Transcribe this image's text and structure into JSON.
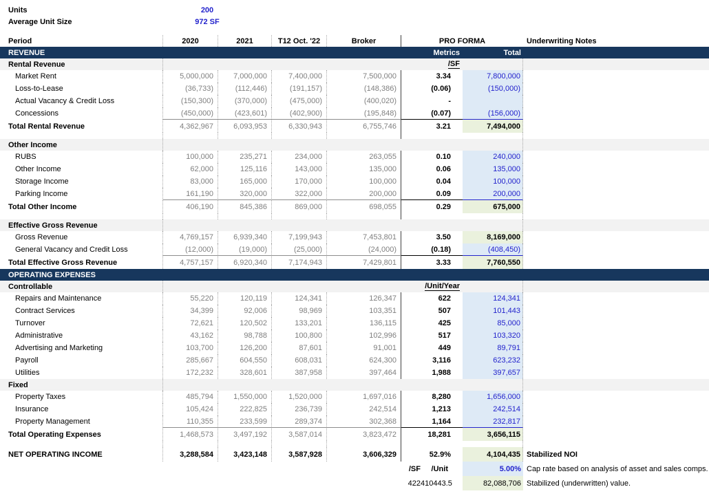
{
  "theme": {
    "navy": "#17375D",
    "blue": "#2222CC",
    "lightblue": "#DEEAF6",
    "green": "#EAF1DD",
    "gray": "#7F7F7F",
    "band": "#F2F2F2"
  },
  "info": {
    "units_label": "Units",
    "units_value": "200",
    "avg_unit_size_label": "Average Unit Size",
    "avg_unit_size_value": "972 SF"
  },
  "columns": {
    "period": "Period",
    "y2020": "2020",
    "y2021": "2021",
    "t12": "T12 Oct. '22",
    "broker": "Broker",
    "pro_forma": "PRO FORMA",
    "metrics": "Metrics",
    "total": "Total",
    "notes": "Underwriting Notes"
  },
  "rows": [
    {
      "type": "colheader"
    },
    {
      "type": "bar",
      "label": "REVENUE",
      "metrics_label": "Metrics",
      "total_label": "Total"
    },
    {
      "type": "sub",
      "label": "Rental Revenue",
      "metrics_header": "/SF"
    },
    {
      "type": "data",
      "label": "Market Rent",
      "values": [
        "5,000,000",
        "7,000,000",
        "7,400,000",
        "7,500,000"
      ],
      "metrics": "3.34",
      "total": "7,800,000",
      "highlight": "blue"
    },
    {
      "type": "data",
      "label": "Loss-to-Lease",
      "values": [
        "(36,733)",
        "(112,446)",
        "(191,157)",
        "(148,386)"
      ],
      "metrics": "(0.06)",
      "total": "(150,000)",
      "highlight": "blue"
    },
    {
      "type": "data",
      "label": "Actual Vacancy & Credit Loss",
      "values": [
        "(150,300)",
        "(370,000)",
        "(475,000)",
        "(400,020)"
      ],
      "metrics": "-",
      "total": "",
      "highlight": "blue"
    },
    {
      "type": "data",
      "label": "Concessions",
      "values": [
        "(450,000)",
        "(423,601)",
        "(402,900)",
        "(195,848)"
      ],
      "metrics": "(0.07)",
      "total": "(156,000)",
      "highlight": "blue",
      "underline": true
    },
    {
      "type": "total",
      "label": "Total Rental Revenue",
      "values": [
        "4,362,967",
        "6,093,953",
        "6,330,943",
        "6,755,746"
      ],
      "metrics": "3.21",
      "total": "7,494,000"
    },
    {
      "type": "gap"
    },
    {
      "type": "sub",
      "label": "Other Income"
    },
    {
      "type": "data",
      "label": "RUBS",
      "values": [
        "100,000",
        "235,271",
        "234,000",
        "263,055"
      ],
      "metrics": "0.10",
      "total": "240,000",
      "highlight": "blue"
    },
    {
      "type": "data",
      "label": "Other Income",
      "values": [
        "62,000",
        "125,116",
        "143,000",
        "135,000"
      ],
      "metrics": "0.06",
      "total": "135,000",
      "highlight": "blue"
    },
    {
      "type": "data",
      "label": "Storage Income",
      "values": [
        "83,000",
        "165,000",
        "170,000",
        "100,000"
      ],
      "metrics": "0.04",
      "total": "100,000",
      "highlight": "blue"
    },
    {
      "type": "data",
      "label": "Parking Income",
      "values": [
        "161,190",
        "320,000",
        "322,000",
        "200,000"
      ],
      "metrics": "0.09",
      "total": "200,000",
      "highlight": "blue",
      "underline": true
    },
    {
      "type": "total",
      "label": "Total Other Income",
      "values": [
        "406,190",
        "845,386",
        "869,000",
        "698,055"
      ],
      "metrics": "0.29",
      "total": "675,000"
    },
    {
      "type": "gap"
    },
    {
      "type": "sub",
      "label": "Effective Gross Revenue"
    },
    {
      "type": "data",
      "label": "Gross Revenue",
      "values": [
        "4,769,157",
        "6,939,340",
        "7,199,943",
        "7,453,801"
      ],
      "metrics": "3.50",
      "total": "8,169,000",
      "highlight": "green"
    },
    {
      "type": "data",
      "label": "General Vacancy and Credit Loss",
      "values": [
        "(12,000)",
        "(19,000)",
        "(25,000)",
        "(24,000)"
      ],
      "metrics": "(0.18)",
      "total": "(408,450)",
      "highlight": "blue",
      "underline": true
    },
    {
      "type": "total",
      "label": "Total Effective Gross Revenue",
      "values": [
        "4,757,157",
        "6,920,340",
        "7,174,943",
        "7,429,801"
      ],
      "metrics": "3.33",
      "total": "7,760,550"
    },
    {
      "type": "bar",
      "label": "OPERATING EXPENSES",
      "metrics_label": "",
      "total_label": ""
    },
    {
      "type": "sub",
      "label": "Controllable",
      "metrics_header": "/Unit/Year"
    },
    {
      "type": "data",
      "label": "Repairs and Maintenance",
      "values": [
        "55,220",
        "120,119",
        "124,341",
        "126,347"
      ],
      "metrics": "622",
      "total": "124,341",
      "highlight": "blue"
    },
    {
      "type": "data",
      "label": "Contract Services",
      "values": [
        "34,399",
        "92,006",
        "98,969",
        "103,351"
      ],
      "metrics": "507",
      "total": "101,443",
      "highlight": "blue"
    },
    {
      "type": "data",
      "label": "Turnover",
      "values": [
        "72,621",
        "120,502",
        "133,201",
        "136,115"
      ],
      "metrics": "425",
      "total": "85,000",
      "highlight": "blue"
    },
    {
      "type": "data",
      "label": "Administrative",
      "values": [
        "43,162",
        "98,788",
        "100,800",
        "102,996"
      ],
      "metrics": "517",
      "total": "103,320",
      "highlight": "blue"
    },
    {
      "type": "data",
      "label": "Advertising and Marketing",
      "values": [
        "103,700",
        "126,200",
        "87,601",
        "91,001"
      ],
      "metrics": "449",
      "total": "89,791",
      "highlight": "blue"
    },
    {
      "type": "data",
      "label": "Payroll",
      "values": [
        "285,667",
        "604,550",
        "608,031",
        "624,300"
      ],
      "metrics": "3,116",
      "total": "623,232",
      "highlight": "blue"
    },
    {
      "type": "data",
      "label": "Utilities",
      "values": [
        "172,232",
        "328,601",
        "387,958",
        "397,464"
      ],
      "metrics": "1,988",
      "total": "397,657",
      "highlight": "blue"
    },
    {
      "type": "sub",
      "label": "Fixed"
    },
    {
      "type": "data",
      "label": "Property Taxes",
      "values": [
        "485,794",
        "1,550,000",
        "1,520,000",
        "1,697,016"
      ],
      "metrics": "8,280",
      "total": "1,656,000",
      "highlight": "blue"
    },
    {
      "type": "data",
      "label": "Insurance",
      "values": [
        "105,424",
        "222,825",
        "236,739",
        "242,514"
      ],
      "metrics": "1,213",
      "total": "242,514",
      "highlight": "blue"
    },
    {
      "type": "data",
      "label": "Property Management",
      "values": [
        "110,355",
        "233,599",
        "289,374",
        "302,368"
      ],
      "metrics": "1,164",
      "total": "232,817",
      "highlight": "blue",
      "underline": true
    },
    {
      "type": "total",
      "label": "Total Operating Expenses",
      "values": [
        "1,468,573",
        "3,497,192",
        "3,587,014",
        "3,823,472"
      ],
      "metrics": "18,281",
      "total": "3,656,115"
    },
    {
      "type": "gap"
    },
    {
      "type": "noi",
      "label": "NET OPERATING INCOME",
      "values": [
        "3,288,584",
        "3,423,148",
        "3,587,928",
        "3,606,329"
      ],
      "metrics": "52.9%",
      "total": "4,104,435",
      "note": "Stabilized NOI"
    },
    {
      "type": "sub2",
      "sf": "/SF",
      "unit": "/Unit",
      "bold_labels": true,
      "total": "5.00%",
      "highlight": "blue_bold",
      "note": "Cap rate based on analysis of asset and sales comps."
    },
    {
      "type": "sub2",
      "sf": "422",
      "unit": "410443.5",
      "bold_labels": false,
      "total": "82,088,706",
      "highlight": "green_plain",
      "note": "Stabilized (underwritten) value."
    }
  ]
}
